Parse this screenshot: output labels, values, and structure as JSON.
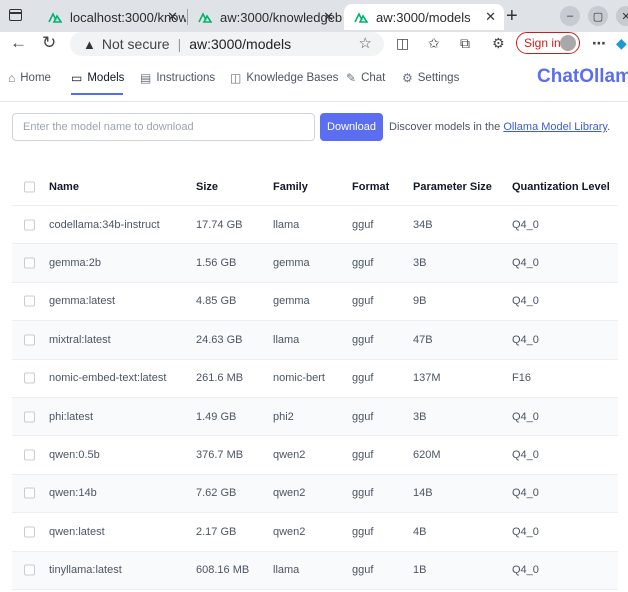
{
  "browser": {
    "tabs": [
      {
        "label": "localhost:3000/knowl"
      },
      {
        "label": "aw:3000/knowledgeb"
      },
      {
        "label": "aw:3000/models"
      }
    ],
    "address": {
      "security_label": "Not secure",
      "url": "aw:3000/models"
    },
    "signin_label": "Sign in"
  },
  "nav": {
    "items": [
      {
        "label": "Home",
        "icon": "home-icon"
      },
      {
        "label": "Models",
        "icon": "models-icon"
      },
      {
        "label": "Instructions",
        "icon": "document-icon"
      },
      {
        "label": "Knowledge Bases",
        "icon": "book-icon"
      },
      {
        "label": "Chat",
        "icon": "pencil-icon"
      },
      {
        "label": "Settings",
        "icon": "gear-icon"
      }
    ],
    "brand": "ChatOllama"
  },
  "download": {
    "placeholder": "Enter the model name to download",
    "button_label": "Download",
    "discover_text": "Discover models in the",
    "library_link": "Ollama Model Library",
    "discover_suffix": "."
  },
  "table": {
    "columns": [
      "Name",
      "Size",
      "Family",
      "Format",
      "Parameter Size",
      "Quantization Level"
    ],
    "rows": [
      {
        "name": "codellama:34b-instruct",
        "size": "17.74 GB",
        "family": "llama",
        "format": "gguf",
        "param": "34B",
        "quant": "Q4_0"
      },
      {
        "name": "gemma:2b",
        "size": "1.56 GB",
        "family": "gemma",
        "format": "gguf",
        "param": "3B",
        "quant": "Q4_0"
      },
      {
        "name": "gemma:latest",
        "size": "4.85 GB",
        "family": "gemma",
        "format": "gguf",
        "param": "9B",
        "quant": "Q4_0"
      },
      {
        "name": "mixtral:latest",
        "size": "24.63 GB",
        "family": "llama",
        "format": "gguf",
        "param": "47B",
        "quant": "Q4_0"
      },
      {
        "name": "nomic-embed-text:latest",
        "size": "261.6 MB",
        "family": "nomic-bert",
        "format": "gguf",
        "param": "137M",
        "quant": "F16"
      },
      {
        "name": "phi:latest",
        "size": "1.49 GB",
        "family": "phi2",
        "format": "gguf",
        "param": "3B",
        "quant": "Q4_0"
      },
      {
        "name": "qwen:0.5b",
        "size": "376.7 MB",
        "family": "qwen2",
        "format": "gguf",
        "param": "620M",
        "quant": "Q4_0"
      },
      {
        "name": "qwen:14b",
        "size": "7.62 GB",
        "family": "qwen2",
        "format": "gguf",
        "param": "14B",
        "quant": "Q4_0"
      },
      {
        "name": "qwen:latest",
        "size": "2.17 GB",
        "family": "qwen2",
        "format": "gguf",
        "param": "4B",
        "quant": "Q4_0"
      },
      {
        "name": "tinyllama:latest",
        "size": "608.16 MB",
        "family": "llama",
        "format": "gguf",
        "param": "1B",
        "quant": "Q4_0"
      }
    ]
  },
  "colors": {
    "accent": "#5b6ef0",
    "link": "#3b5bdb"
  }
}
